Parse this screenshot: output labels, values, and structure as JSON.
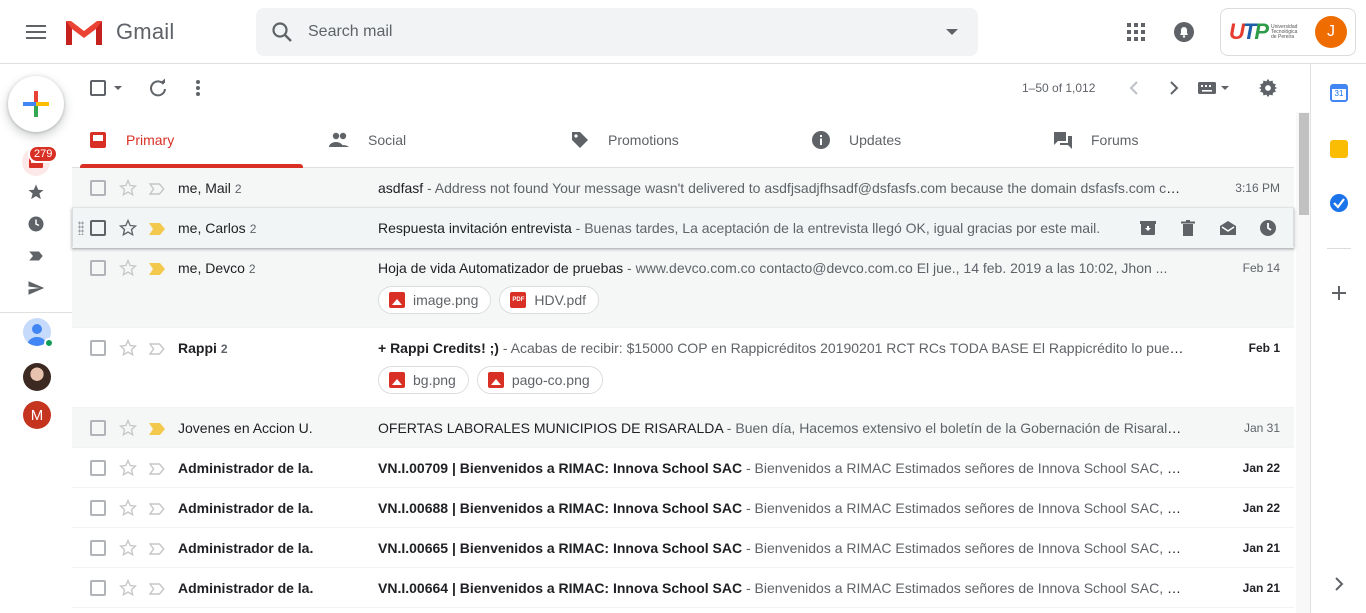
{
  "app": {
    "name": "Gmail"
  },
  "search": {
    "placeholder": "Search mail"
  },
  "account": {
    "avatar_letter": "J",
    "org_logo_text": "UTP",
    "org_logo_subtext": "Universidad Tecnológica de Pereira"
  },
  "nav": {
    "inbox_badge": "279",
    "contact_initial": "M"
  },
  "toolbar": {
    "page_info": "1–50 of 1,012"
  },
  "tabs": [
    {
      "label": "Primary",
      "icon": "inbox-icon",
      "active": true
    },
    {
      "label": "Social",
      "icon": "people-icon",
      "active": false
    },
    {
      "label": "Promotions",
      "icon": "tag-icon",
      "active": false
    },
    {
      "label": "Updates",
      "icon": "info-icon",
      "active": false
    },
    {
      "label": "Forums",
      "icon": "forum-icon",
      "active": false
    }
  ],
  "side_panel": {
    "calendar_day": "31"
  },
  "emails": [
    {
      "sender": "me, Mail",
      "count": "2",
      "subject": "asdfasf",
      "snippet": " - Address not found Your message wasn't delivered to asdfjsadjfhsadf@dsfasfs.com because the domain dsfasfs.com couldn't be found.",
      "date": "3:16 PM",
      "unread": false,
      "important": false,
      "attachments": []
    },
    {
      "sender": "me, Carlos",
      "count": "2",
      "subject": "Respuesta invitación entrevista",
      "snippet": " - Buenas tardes, La aceptación de la entrevista llegó OK, igual gracias por este mail.",
      "date": "",
      "unread": false,
      "important": true,
      "attachments": []
    },
    {
      "sender": "me, Devco",
      "count": "2",
      "subject": "Hoja de vida Automatizador de pruebas",
      "snippet": " - www.devco.com.co contacto@devco.com.co El jue., 14 feb. 2019 a las 10:02, Jhon ...",
      "date": "Feb 14",
      "unread": false,
      "important": true,
      "attachments": [
        {
          "name": "image.png",
          "kind": "image"
        },
        {
          "name": "HDV.pdf",
          "kind": "pdf"
        }
      ]
    },
    {
      "sender": "Rappi",
      "count": "2",
      "subject": "+ Rappi Credits! ;)",
      "snippet": " - Acabas de recibir: $15000 COP en Rappicréditos 20190201 RCT RCs TODA BASE El Rappicrédito lo puede...",
      "date": "Feb 1",
      "unread": true,
      "important": false,
      "attachments": [
        {
          "name": "bg.png",
          "kind": "image"
        },
        {
          "name": "pago-co.png",
          "kind": "image"
        }
      ]
    },
    {
      "sender": "Jovenes en Accion U.",
      "count": "",
      "subject": "OFERTAS LABORALES MUNICIPIOS DE RISARALDA",
      "snippet": " - Buen día, Hacemos extensivo el boletín de la Gobernación de Risaralda r...",
      "date": "Jan 31",
      "unread": false,
      "important": true,
      "attachments": []
    },
    {
      "sender": "Administrador de la.",
      "count": "",
      "subject": "VN.I.00709 | Bienvenidos a RIMAC: Innova School SAC",
      "snippet": " - Bienvenidos a RIMAC Estimados señores de Innova School SAC, qu...",
      "date": "Jan 22",
      "unread": true,
      "important": false,
      "attachments": []
    },
    {
      "sender": "Administrador de la.",
      "count": "",
      "subject": "VN.I.00688 | Bienvenidos a RIMAC: Innova School SAC",
      "snippet": " - Bienvenidos a RIMAC Estimados señores de Innova School SAC, qu...",
      "date": "Jan 22",
      "unread": true,
      "important": false,
      "attachments": []
    },
    {
      "sender": "Administrador de la.",
      "count": "",
      "subject": "VN.I.00665 | Bienvenidos a RIMAC: Innova School SAC",
      "snippet": " - Bienvenidos a RIMAC Estimados señores de Innova School SAC, qu...",
      "date": "Jan 21",
      "unread": true,
      "important": false,
      "attachments": []
    },
    {
      "sender": "Administrador de la.",
      "count": "",
      "subject": "VN.I.00664 | Bienvenidos a RIMAC: Innova School SAC",
      "snippet": " - Bienvenidos a RIMAC Estimados señores de Innova School SAC, qu...",
      "date": "Jan 21",
      "unread": true,
      "important": false,
      "attachments": []
    }
  ],
  "colors": {
    "accent": "#d93025",
    "important": "#f2c94c",
    "brand_blue": "#4285f4"
  }
}
